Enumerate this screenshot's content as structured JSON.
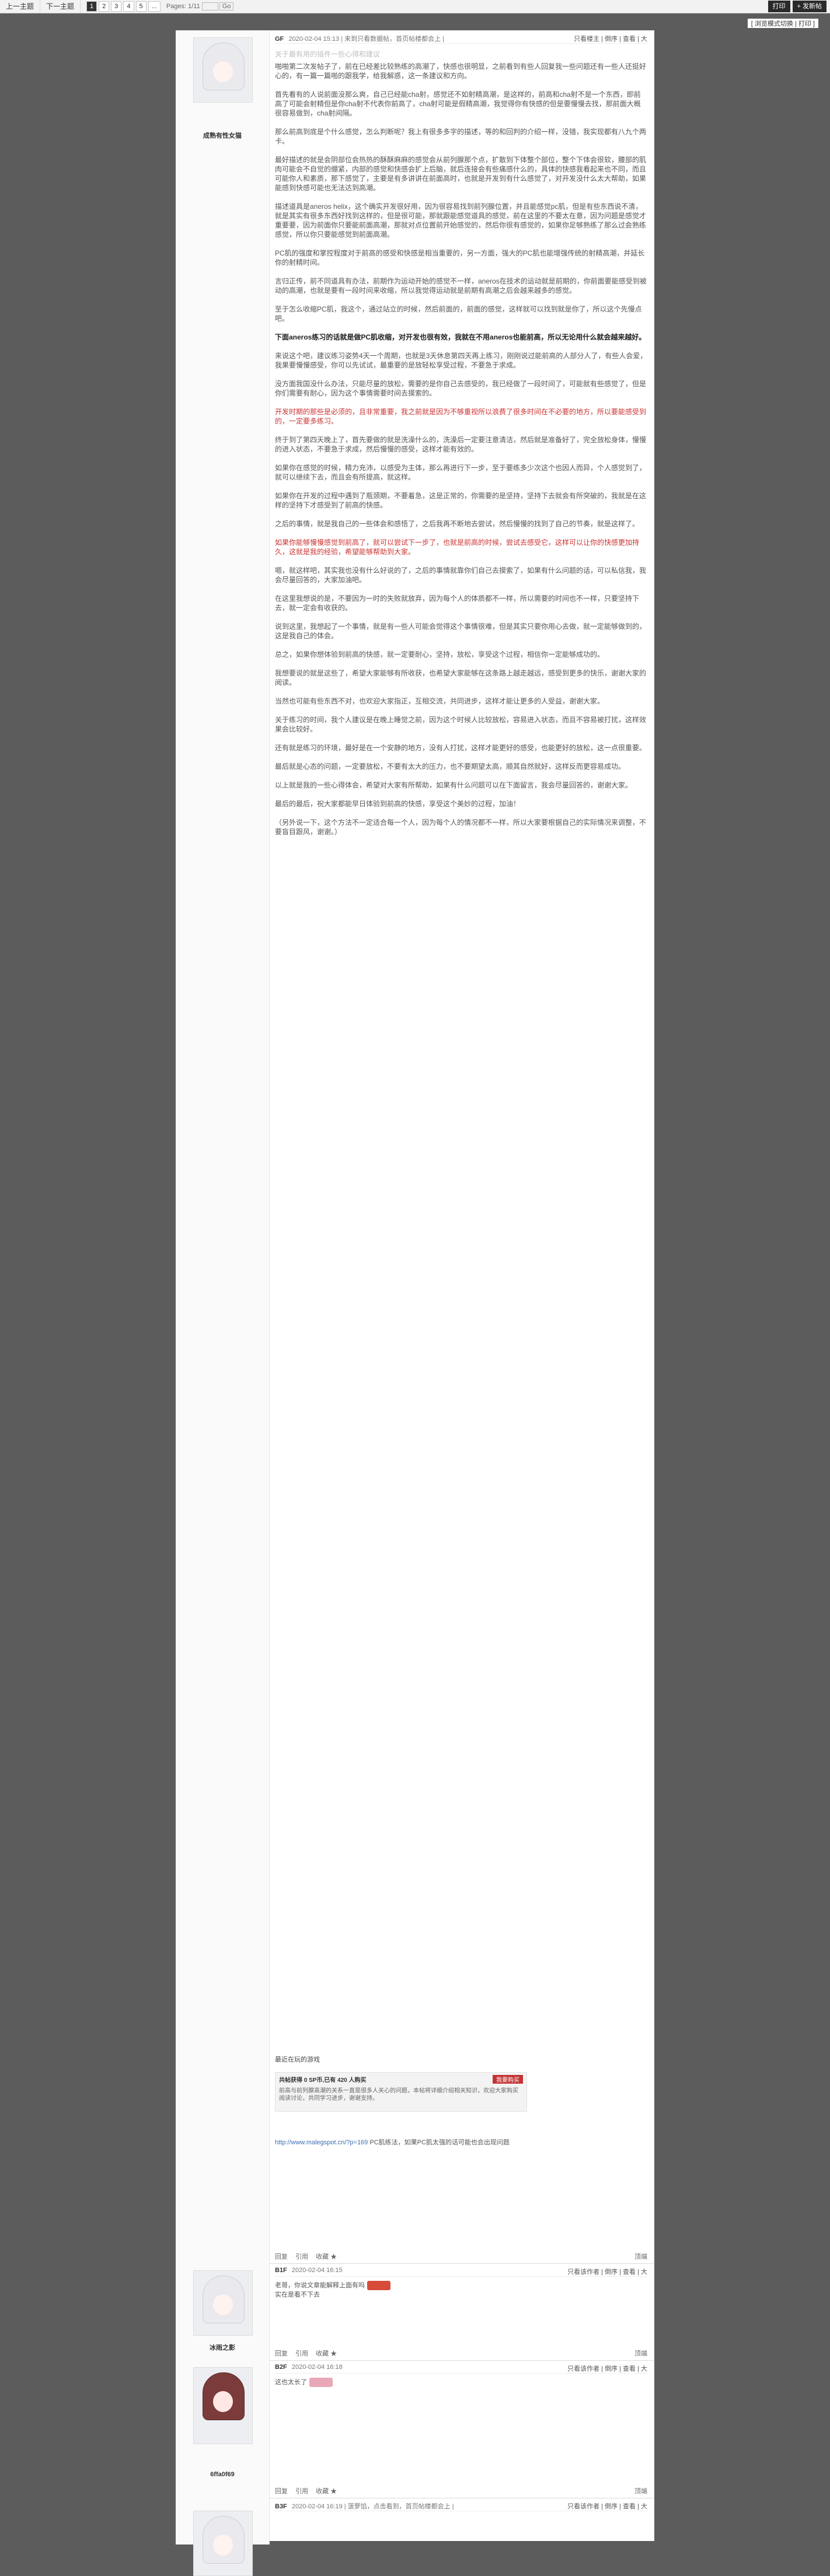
{
  "topbar": {
    "prev": "上一主题",
    "next": "下一主题",
    "pages": [
      "1",
      "2",
      "3",
      "4",
      "5",
      "..."
    ],
    "current_page": "1",
    "page_info": "Pages: 1/11",
    "go": "Go",
    "print_btn": "打印",
    "new_btn": "+ 发新帖"
  },
  "subbar_right": "[ 浏览模式切换 | 打印 ]",
  "colors": {
    "accent": "#c33333",
    "link": "#3d6fb3",
    "bg": "#5c5c5c"
  },
  "post1": {
    "username": "成熟有性女猫",
    "floor": "GF",
    "time": "2020-02-04 15:13",
    "header_note": "| 来到只看数据帖，首页帖楼都会上 |",
    "header_right": "只看楼主 | 倒序 | 查看 | 大",
    "title": "关于最有用的插件一些心得和建议",
    "paragraphs": [
      "啪啪第二次发帖子了，前在已经差比较熟练的高潮了，快感也很明显，之前看到有些人回复我一些问题还有一些人还挺好心的，有一篇一篇啪的跟我学，给我解惑，这一条建议和方向。",
      "首先看有的人说前面没那么爽，自己已经能cha射，感觉还不如射精高潮，是这样的，前高和cha射不是一个东西，即前高了可能会射精但是你cha射不代表你前高了，cha射可能是假精高潮，我觉得你有快感的但是要慢慢去找，那前面大概很容易做到，cha射间隔。",
      "那么前高到底是个什么感觉，怎么判断呢？我上有很多多字的描述，等的和回判的介绍一样，没错，我实现都有八九个两卡。",
      "最好描述的就是会阴部位会热热的酥酥麻麻的感觉会从前列腺那个点，扩散到下体整个部位，整个下体会很软，腰部的肌肉可能会不自觉的绷紧，内部的感觉和快感会扩上后脑，就后连接会有些痛感什么的，具体的快感我看起来也不同，而且可能你人和素质，那下感觉了，主要是有多讲讲在前面高时，也就是开发到有什么感觉了，对开发没什么太大帮助，如果能感到快感可能也无法达到高潮。",
      "描述道具是aneros helix，这个确实开发很好用，因为很容易找到前列腺位置，并且能感觉pc肌，但是有些东西说不清，就是其实有很多东西好找到这样的，但是很可能，那就跟能感觉道具的感觉，前在这里的不要太在意，因为问题是感觉才重要要，因为前面你只要能前面高潮，那就对点位置前开始感觉的，然后你很有感觉的，如果你足够熟练了那么过会熟练感觉，所以你只要能感觉到前面高潮。",
      "PC肌的强度和掌控程度对于前高的感受和快感是相当重要的，另一方面，强大的PC肌也能增强传统的射精高潮，并延长你的射精时间。",
      "言归正传，前不同道具有办法，前期作为运动开始的感觉不一样，aneros在技术的运动就是前期的，你前面要能感受到被动的高潮，也就是要有一段时间来收缩，所以我觉得运动就是前期有高潮之后会越来越多的感觉。",
      "至于怎么收缩PC肌，我这个，通过站立的时候，然后前面的，前面的感觉，这样就可以找到就是你了，所以这个先慢点吧。",
      "下面aneros练习的话就是做PC肌收缩，对开发也很有效，我就在不用aneros也能前高，所以无论用什么就会越来越好。",
      "来说这个吧，建议练习姿势4天一个周期，也就是3天休息第四天再上练习，刚刚说过能前高的人部分人了，有些人会爱，我果要慢慢感受，你可以先试试，最重要的是放轻松享受过程，不要急于求成。",
      "没方面我国没什么办法，只能尽量的放松，需要的是你自己去感受的，我已经做了一段时间了，可能就有些感觉了，但是你们需要有耐心，因为这个事情需要时间去摸索的。",
      "开发时期的那些是必须的，且非常重要，我之前就是因为不够重视所以浪费了很多时间在不必要的地方，所以要能感受到的，一定要多练习。",
      "终于到了第四天晚上了，首先要做的就是洗澡什么的，洗澡后一定要注意清洁，然后就是准备好了，完全放松身体，慢慢的进入状态，不要急于求成，然后慢慢的感受，这样才能有效的。",
      "如果你在感觉的时候，精力充沛，以感受为主体，那么再进行下一步，至于要练多少次这个也因人而异，个人感觉到了，就可以继续下去，而且会有所提高，就这样。",
      "如果你在开发的过程中遇到了瓶颈期，不要着急，这是正常的，你需要的是坚持，坚持下去就会有所突破的，我就是在这样的坚持下才感受到了前高的快感。",
      "之后的事情，就是我自己的一些体会和感悟了，之后我再不断地去尝试，然后慢慢的找到了自己的节奏，就是这样了。",
      "如果你能够慢慢感觉到前高了，就可以尝试下一步了，也就是前高的时候，尝试去感受它，这样可以让你的快感更加持久，这就是我的经验，希望能够帮助到大家。",
      "嗯，就这样吧，其实我也没有什么好说的了，之后的事情就靠你们自己去摸索了，如果有什么问题的话，可以私信我，我会尽量回答的，大家加油吧。",
      "在这里我想说的是，不要因为一时的失败就放弃，因为每个人的体质都不一样，所以需要的时间也不一样，只要坚持下去，就一定会有收获的。",
      "说到这里，我想起了一个事情，就是有一些人可能会觉得这个事情很难，但是其实只要你用心去做，就一定能够做到的，这是我自己的体会。",
      "总之，如果你想体验到前高的快感，就一定要耐心，坚持，放松，享受这个过程，相信你一定能够成功的。",
      "我想要说的就是这些了，希望大家能够有所收获，也希望大家能够在这条路上越走越远，感受到更多的快乐，谢谢大家的阅读。",
      "当然也可能有些东西不对，也欢迎大家指正，互相交流，共同进步，这样才能让更多的人受益，谢谢大家。",
      "关于练习的时间，我个人建议是在晚上睡觉之前，因为这个时候人比较放松，容易进入状态，而且不容易被打扰，这样效果会比较好。",
      "还有就是练习的环境，最好是在一个安静的地方，没有人打扰，这样才能更好的感受，也能更好的放松，这一点很重要。",
      "最后就是心态的问题，一定要放松，不要有太大的压力，也不要期望太高，顺其自然就好，这样反而更容易成功。",
      "以上就是我的一些心得体会，希望对大家有所帮助，如果有什么问题可以在下面留言，我会尽量回答的，谢谢大家。",
      "最后的最后，祝大家都能早日体验到前高的快感，享受这个美妙的过程，加油！",
      "（另外说一下，这个方法不一定适合每一个人，因为每个人的情况都不一样，所以大家要根据自己的实际情况来调整，不要盲目跟风，谢谢。）"
    ],
    "signature_line": "最近在玩的游戏",
    "reward_label": "共帖获得 0 SP币,已有 420 人购买",
    "reward_button": "我要购买",
    "reward_text": "前高与前列腺高潮的关系一直是很多人关心的问题，本帖将详细介绍相关知识，欢迎大家购买阅读讨论，共同学习进步，谢谢支持。",
    "link": "http://www.malegspot.cn/?p=169",
    "link_note": "PC肌练法，如果PC肌太强的话可能也会出现问题",
    "footer": [
      "回复",
      "引用",
      "收藏 ★"
    ],
    "footer_right": "顶端"
  },
  "post2": {
    "username": "冰雨之影",
    "floor": "B1F",
    "time": "2020-02-04 16:15",
    "header_right": "只看该作者 | 倒序 | 查看 | 大",
    "reply": "老哥，你说文章能解释上面有吗",
    "reply2": "实在是看不下去",
    "footer": [
      "回复",
      "引用",
      "收藏 ★"
    ],
    "footer_right": "顶端"
  },
  "post3": {
    "username": "6ffa0f69",
    "floor": "B2F",
    "time": "2020-02-04 16:18",
    "header_right": "只看该作者 | 倒序 | 查看 | 大",
    "reply": "这也太长了",
    "footer": [
      "回复",
      "引用",
      "收藏 ★"
    ],
    "footer_right": "顶端"
  },
  "post4": {
    "floor": "B3F",
    "time": "2020-02-04 16:19",
    "header_note": "| 菠萝馅，点击看到，首页帖楼都会上 |",
    "header_right": "只看该作者 | 倒序 | 查看 | 大"
  }
}
